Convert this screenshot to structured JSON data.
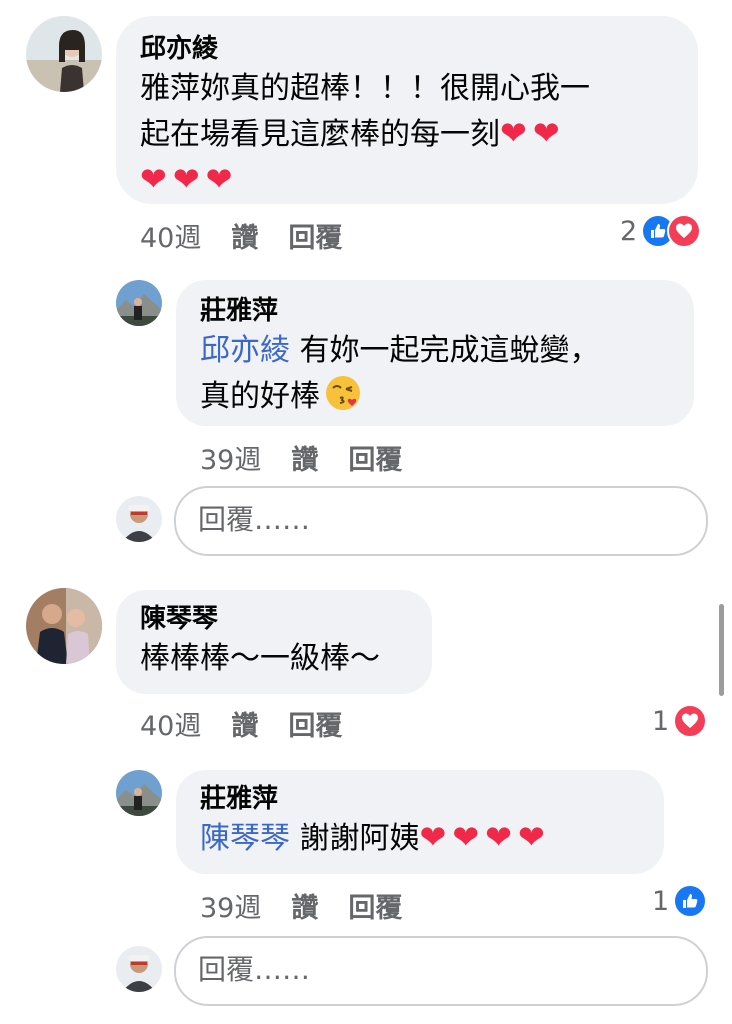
{
  "comments": [
    {
      "author": "邱亦綾",
      "line1": "雅萍妳真的超棒！！！很開心我一",
      "line2": "起在場看見這麼棒的每一刻",
      "time": "40週",
      "like_label": "讚",
      "reply_label": "回覆",
      "reaction_count": "2",
      "reactions": [
        "like-icon",
        "love-icon"
      ],
      "reply": {
        "author": "莊雅萍",
        "mention": "邱亦綾",
        "text_after_mention": " 有妳一起完成這蛻變，",
        "line2": "真的好棒",
        "time": "39週",
        "like_label": "讚",
        "reply_label": "回覆"
      },
      "reply_input_placeholder": "回覆……"
    },
    {
      "author": "陳琴琴",
      "text": "棒棒棒～一級棒～",
      "time": "40週",
      "like_label": "讚",
      "reply_label": "回覆",
      "reaction_count": "1",
      "reactions": [
        "love-icon"
      ],
      "reply": {
        "author": "莊雅萍",
        "mention": "陳琴琴",
        "text_after_mention": " 謝謝阿姨",
        "time": "39週",
        "like_label": "讚",
        "reply_label": "回覆",
        "reaction_count": "1",
        "reactions": [
          "like-icon"
        ]
      },
      "reply_input_placeholder": "回覆……"
    }
  ],
  "colors": {
    "bubble": "#f0f2f5",
    "mention": "#3a67c8",
    "meta": "#65676b",
    "heart": "#f02849",
    "like": "#1877f2",
    "love": "#f33e58"
  }
}
